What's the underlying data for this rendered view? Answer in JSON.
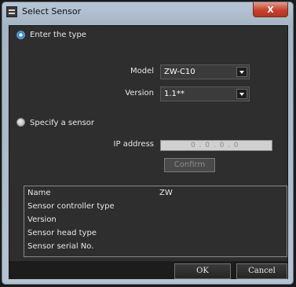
{
  "window": {
    "title": "Select Sensor",
    "close_glyph": "X"
  },
  "mode": {
    "enter_type_label": "Enter the type",
    "specify_sensor_label": "Specify a sensor",
    "selected": "enter_type"
  },
  "type_fields": {
    "model_label": "Model",
    "model_value": "ZW-C10",
    "version_label": "Version",
    "version_value": "1.1**"
  },
  "sensor_fields": {
    "ip_label": "IP address",
    "ip_value": "0 . 0 . 0 . 0",
    "confirm_label": "Confirm"
  },
  "info": {
    "rows": [
      {
        "label": "Name",
        "value": "ZW"
      },
      {
        "label": "Sensor controller type",
        "value": ""
      },
      {
        "label": "Version",
        "value": ""
      },
      {
        "label": "Sensor head type",
        "value": ""
      },
      {
        "label": "Sensor serial No.",
        "value": ""
      }
    ]
  },
  "buttons": {
    "ok": "OK",
    "cancel": "Cancel"
  },
  "colors": {
    "selected_radio": "#2a7fd6",
    "client_bg": "#2e2e2e",
    "title_bar": "#a3b4c5"
  },
  "icons": [
    "app-icon",
    "close-icon",
    "dropdown-arrow-icon"
  ]
}
